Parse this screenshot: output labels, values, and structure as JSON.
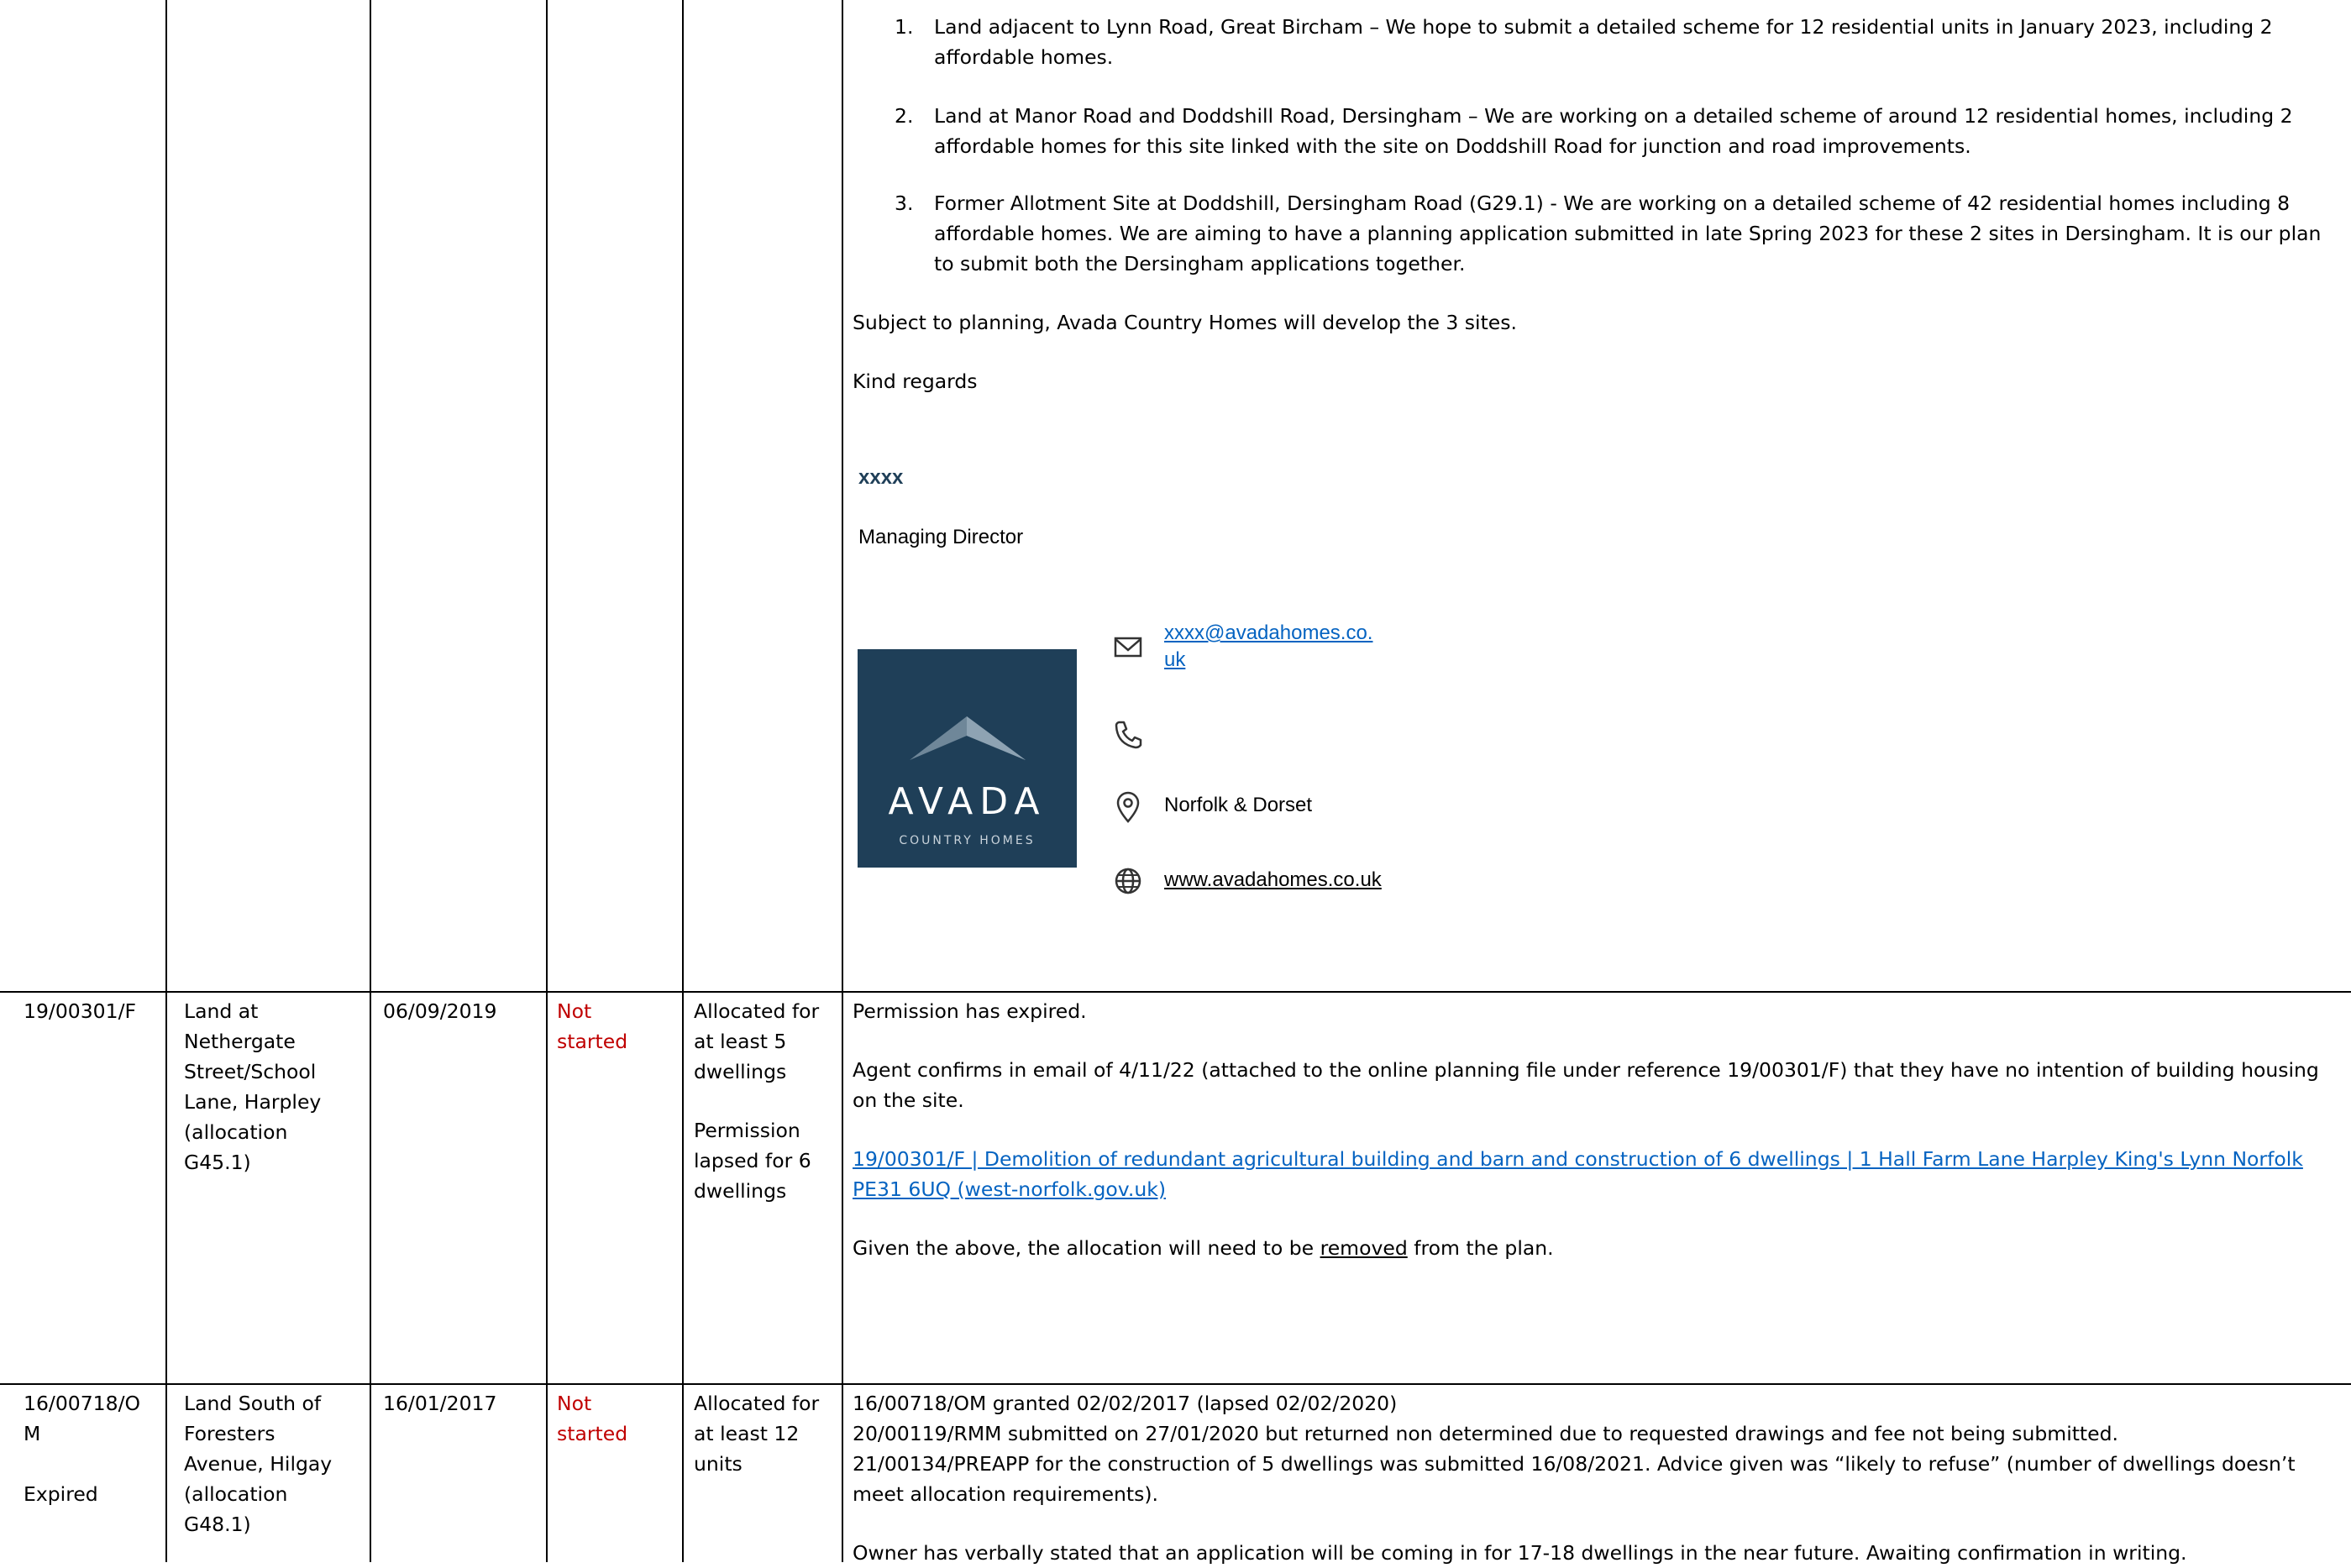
{
  "top_row": {
    "list": [
      {
        "num": "1.",
        "text": "Land adjacent to Lynn Road, Great Bircham – We hope to submit a detailed scheme for 12 residential units in January 2023, including 2 affordable homes."
      },
      {
        "num": "2.",
        "text": "Land at Manor Road and Doddshill Road, Dersingham – We are working on a detailed scheme of around 12 residential homes, including 2 affordable homes for this site linked with the site on Doddshill Road for junction and road improvements."
      },
      {
        "num": "3.",
        "text": "Former Allotment Site at Doddshill, Dersingham Road (G29.1) - We are working on a detailed scheme of 42 residential homes including 8 affordable homes.  We are aiming to have a planning application submitted in late Spring 2023 for these 2 sites in Dersingham.  It is our plan to submit both the Dersingham applications together."
      }
    ],
    "subject_text": "Subject to planning, Avada Country Homes will develop the 3 sites.",
    "regards": "Kind regards",
    "signature": {
      "name": "xxxx",
      "role": "Managing Director",
      "logo_main": "AVADA",
      "logo_sub": "COUNTRY HOMES",
      "email_line1": "xxxx@avadahomes.co.",
      "email_line2": "uk",
      "location": "Norfolk & Dorset",
      "website": "www.avadahomes.co.uk"
    }
  },
  "row_harpley": {
    "ref": "19/00301/F",
    "site": [
      "Land at",
      "Nethergate",
      "Street/School",
      "Lane, Harpley",
      "(allocation",
      "G45.1)"
    ],
    "date": "06/09/2019",
    "status": [
      "Not",
      "started"
    ],
    "allocation_a": [
      "Allocated for",
      "at least 5",
      "dwellings"
    ],
    "allocation_b": [
      "Permission",
      "lapsed for 6",
      "dwellings"
    ],
    "comment_1": "Permission has expired.",
    "comment_2": "Agent confirms in email of 4/11/22 (attached to the online planning file under reference 19/00301/F) that they have no intention of building housing on the site.",
    "link_line1": "19/00301/F | Demolition of redundant agricultural building and barn and construction of 6 dwellings | 1 Hall Farm Lane Harpley King's Lynn Norfolk",
    "link_line2": "PE31 6UQ (west-norfolk.gov.uk)",
    "comment_3_pre": "Given the above, the allocation will need to be ",
    "comment_3_underline": "removed",
    "comment_3_post": " from the plan."
  },
  "row_hilgay": {
    "ref": [
      "16/00718/O",
      "M"
    ],
    "ref_status": "Expired",
    "site": [
      "Land South of",
      "Foresters",
      "Avenue, Hilgay",
      "(allocation",
      "G48.1)"
    ],
    "date": "16/01/2017",
    "status": [
      "Not",
      "started"
    ],
    "allocation": [
      "Allocated for",
      "at least 12",
      "units"
    ],
    "comment_lines": [
      "16/00718/OM granted 02/02/2017 (lapsed 02/02/2020)",
      "20/00119/RMM submitted on 27/01/2020 but returned non determined due to requested drawings and fee not being submitted.",
      "21/00134/PREAPP for the construction of 5 dwellings was submitted 16/08/2021. Advice given was “likely to refuse” (number of dwellings doesn’t",
      "meet allocation requirements)."
    ],
    "comment_last": "Owner has verbally stated that an application will be coming in for 17-18 dwellings in the near future. Awaiting confirmation in writing."
  },
  "colors": {
    "status_red": "#c00000",
    "link_blue": "#0563c1",
    "logo_navy": "#1f3f58"
  }
}
